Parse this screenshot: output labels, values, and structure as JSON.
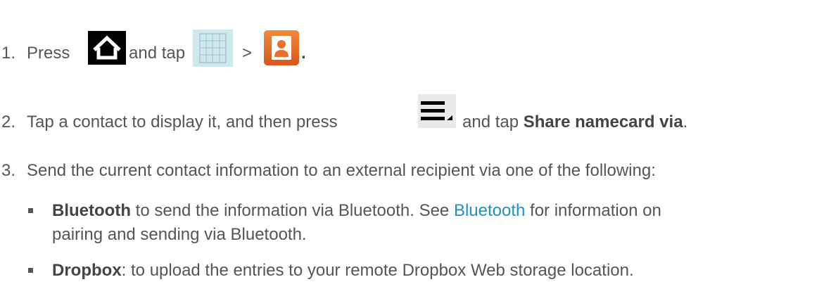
{
  "steps": [
    {
      "number": "1.",
      "press_label": "Press",
      "and_tap_label": "and tap",
      "separator": ">",
      "trailing": ".",
      "icons": [
        "home-key-icon",
        "apps-grid-icon",
        "contacts-app-icon"
      ]
    },
    {
      "number": "2.",
      "text_before": "Tap a contact to display it, and then press",
      "text_middle": "and tap",
      "bold": "Share namecard via",
      "trailing": ".",
      "icons": [
        "menu-key-icon"
      ]
    },
    {
      "number": "3.",
      "text": "Send the current contact information to an external recipient via one of the following:"
    }
  ],
  "options": [
    {
      "bold": "Bluetooth",
      "text_before_link": " to send the information via Bluetooth. See ",
      "link": "Bluetooth",
      "text_after_link": " for information on",
      "continuation": "pairing and sending via Bluetooth."
    },
    {
      "bold": "Dropbox",
      "text": ": to upload the entries to your remote Dropbox Web storage location."
    }
  ],
  "colors": {
    "text": "#555555",
    "link": "#1f8fc7",
    "contacts_icon": "#e8702a",
    "apps_icon_bg": "#cfe8ec"
  }
}
